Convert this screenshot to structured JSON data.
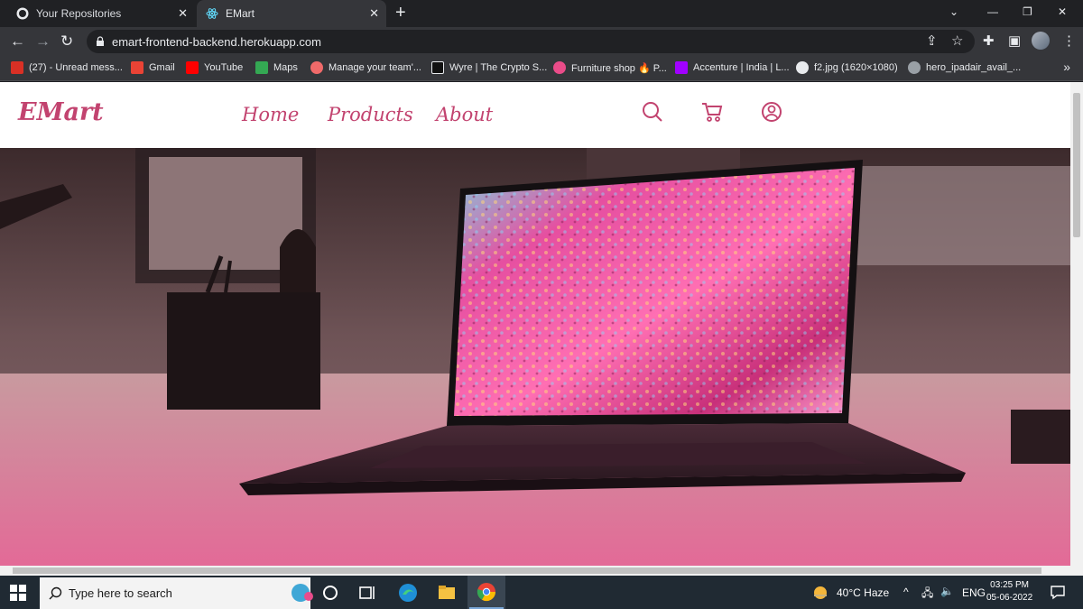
{
  "browser": {
    "tabs": [
      {
        "title": "Your Repositories",
        "active": false
      },
      {
        "title": "EMart",
        "active": true
      }
    ],
    "url": "emart-frontend-backend.herokuapp.com",
    "bookmarks": [
      {
        "label": "(27) - Unread mess...",
        "color": "#d93025"
      },
      {
        "label": "Gmail",
        "color": "#ea4335"
      },
      {
        "label": "YouTube",
        "color": "#ff0000"
      },
      {
        "label": "Maps",
        "color": "#34a853"
      },
      {
        "label": "Manage your team'...",
        "color": "#f06a6a"
      },
      {
        "label": "Wyre | The Crypto S...",
        "color": "#111111"
      },
      {
        "label": "Furniture shop 🔥 P...",
        "color": "#ea4c89"
      },
      {
        "label": "Accenture | India | L...",
        "color": "#a100ff"
      },
      {
        "label": "f2.jpg (1620×1080)",
        "color": "#e8eaed"
      },
      {
        "label": "hero_ipadair_avail_...",
        "color": "#9aa0a6"
      }
    ]
  },
  "site": {
    "brand": "EMart",
    "nav": [
      "Home",
      "Products",
      "About"
    ],
    "accent": "#c2436f",
    "icons": [
      "search-icon",
      "cart-icon",
      "user-icon"
    ]
  },
  "taskbar": {
    "search_placeholder": "Type here to search",
    "weather": "40°C  Haze",
    "lang": "ENG",
    "time": "03:25 PM",
    "date": "05-06-2022"
  }
}
